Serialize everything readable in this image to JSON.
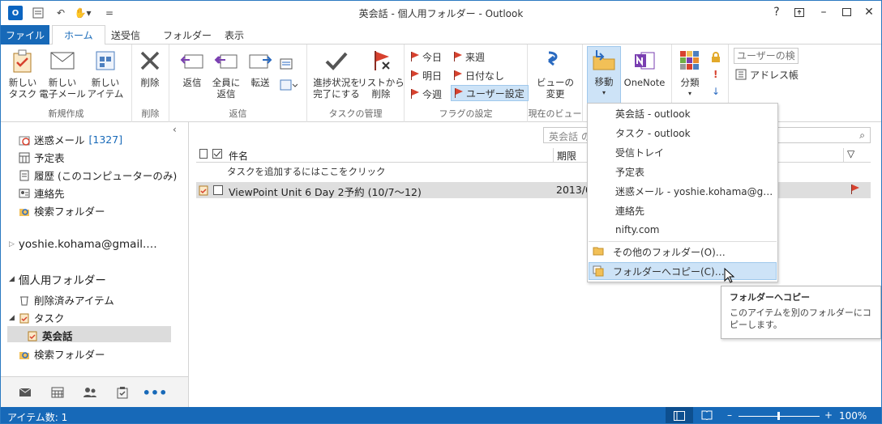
{
  "window": {
    "title": "英会話 - 個人用フォルダー - Outlook",
    "help": "?",
    "app_icon": "O"
  },
  "tabs": [
    {
      "label": "ファイル"
    },
    {
      "label": "ホーム"
    },
    {
      "label": "送受信"
    },
    {
      "label": "フォルダー"
    },
    {
      "label": "表示"
    }
  ],
  "ribbon": {
    "new_task": "新しい\nタスク",
    "new_mail": "新しい\n電子メール",
    "new_items": "新しい\nアイテム",
    "delete": "削除",
    "reply": "返信",
    "reply_all": "全員に\n返信",
    "forward": "転送",
    "mark_complete": "進捗状況を\n完了にする",
    "remove_list": "リストから\n削除",
    "today": "今日",
    "tomorrow": "明日",
    "this_week": "今週",
    "next_week": "来週",
    "no_date": "日付なし",
    "custom": "ユーザー設定",
    "change_view": "ビューの\n変更",
    "move": "移動",
    "onenote": "OneNote",
    "categorize": "分類",
    "search_people_placeholder": "ユーザーの検索",
    "address_book": "アドレス帳",
    "groups": {
      "new": "新規作成",
      "delete": "削除",
      "reply": "返信",
      "manage": "タスクの管理",
      "flags": "フラグの設定",
      "view": "現在のビュー"
    }
  },
  "nav": {
    "junk": "迷惑メール",
    "junk_count": "[1327]",
    "calendar": "予定表",
    "history": "履歴 (このコンピューターのみ)",
    "contacts": "連絡先",
    "search_folders": "検索フォルダー",
    "account": "yoshie.kohama@gmail.…",
    "personal": "個人用フォルダー",
    "deleted": "削除済みアイテム",
    "tasks": "タスク",
    "eikaiwa": "英会話",
    "search_folders2": "検索フォルダー"
  },
  "list": {
    "search_placeholder": "英会話 の",
    "col_subject": "件名",
    "col_due": "期限",
    "add_hint": "タスクを追加するにはここをクリック",
    "task": {
      "subject": "ViewPoint Unit 6 Day 2予約 (10/7〜12)",
      "due": "2013/0"
    }
  },
  "move_menu": [
    "英会話 - outlook",
    "タスク - outlook",
    "受信トレイ",
    "予定表",
    "迷惑メール - yoshie.kohama@g…",
    "連絡先",
    "nifty.com",
    "その他のフォルダー(O)…",
    "フォルダーへコピー(C)…"
  ],
  "tooltip": {
    "title": "フォルダーへコピー",
    "body": "このアイテムを別のフォルダーにコピーします。"
  },
  "status": {
    "items": "アイテム数: 1",
    "zoom": "100%"
  },
  "colors": {
    "accent": "#1769b8",
    "flag": "#d7412e"
  }
}
